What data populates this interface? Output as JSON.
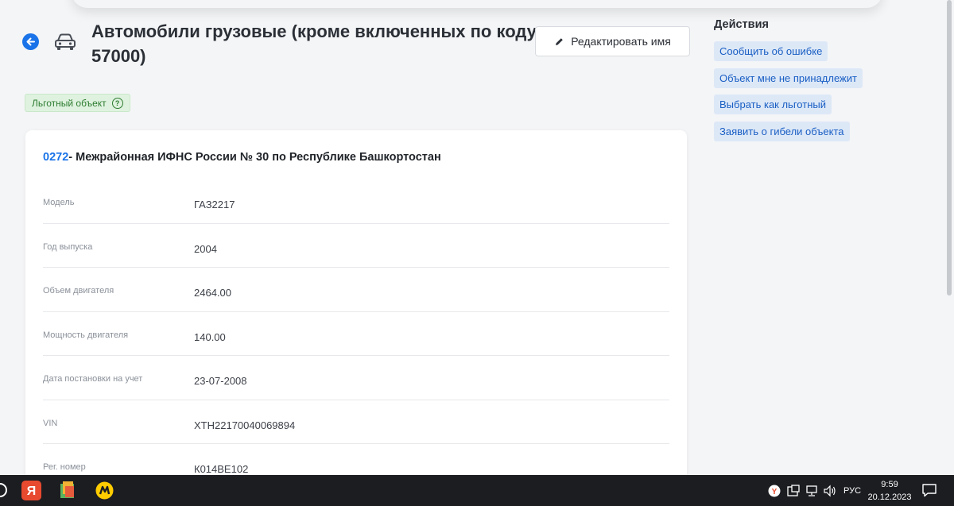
{
  "header": {
    "title": "Автомобили грузовые (кроме включенных по коду 57000)",
    "edit_button_label": "Редактировать имя"
  },
  "badge": {
    "label": "Льготный объект",
    "help_symbol": "?"
  },
  "card": {
    "code": "0272",
    "authority": "- Межрайонная ИФНС России № 30 по Республике Башкортостан",
    "rows": [
      {
        "label": "Модель",
        "value": "ГАЗ2217"
      },
      {
        "label": "Год выпуска",
        "value": "2004"
      },
      {
        "label": "Объем двигателя",
        "value": "2464.00"
      },
      {
        "label": "Мощность двигателя",
        "value": "140.00"
      },
      {
        "label": "Дата постановки на учет",
        "value": "23-07-2008"
      },
      {
        "label": "VIN",
        "value": "XTH22170040069894"
      },
      {
        "label": "Рег. номер",
        "value": "К014ВЕ102"
      }
    ]
  },
  "actions": {
    "title": "Действия",
    "items": [
      {
        "label": "Сообщить об ошибке"
      },
      {
        "label": "Объект мне не принадлежит"
      },
      {
        "label": "Выбрать как льготный"
      },
      {
        "label": "Заявить о гибели объекта"
      }
    ]
  },
  "taskbar": {
    "language": "РУС",
    "time": "9:59",
    "date": "20.12.2023",
    "icons": [
      "yandex-browser-icon",
      "notepad-icon",
      "yandex-market-icon"
    ]
  },
  "colors": {
    "accent": "#1a73e8",
    "badge_bg": "#dff2df",
    "badge_text": "#2e7d32",
    "action_bg": "#dde8f7",
    "taskbar": "#1c1d21"
  }
}
